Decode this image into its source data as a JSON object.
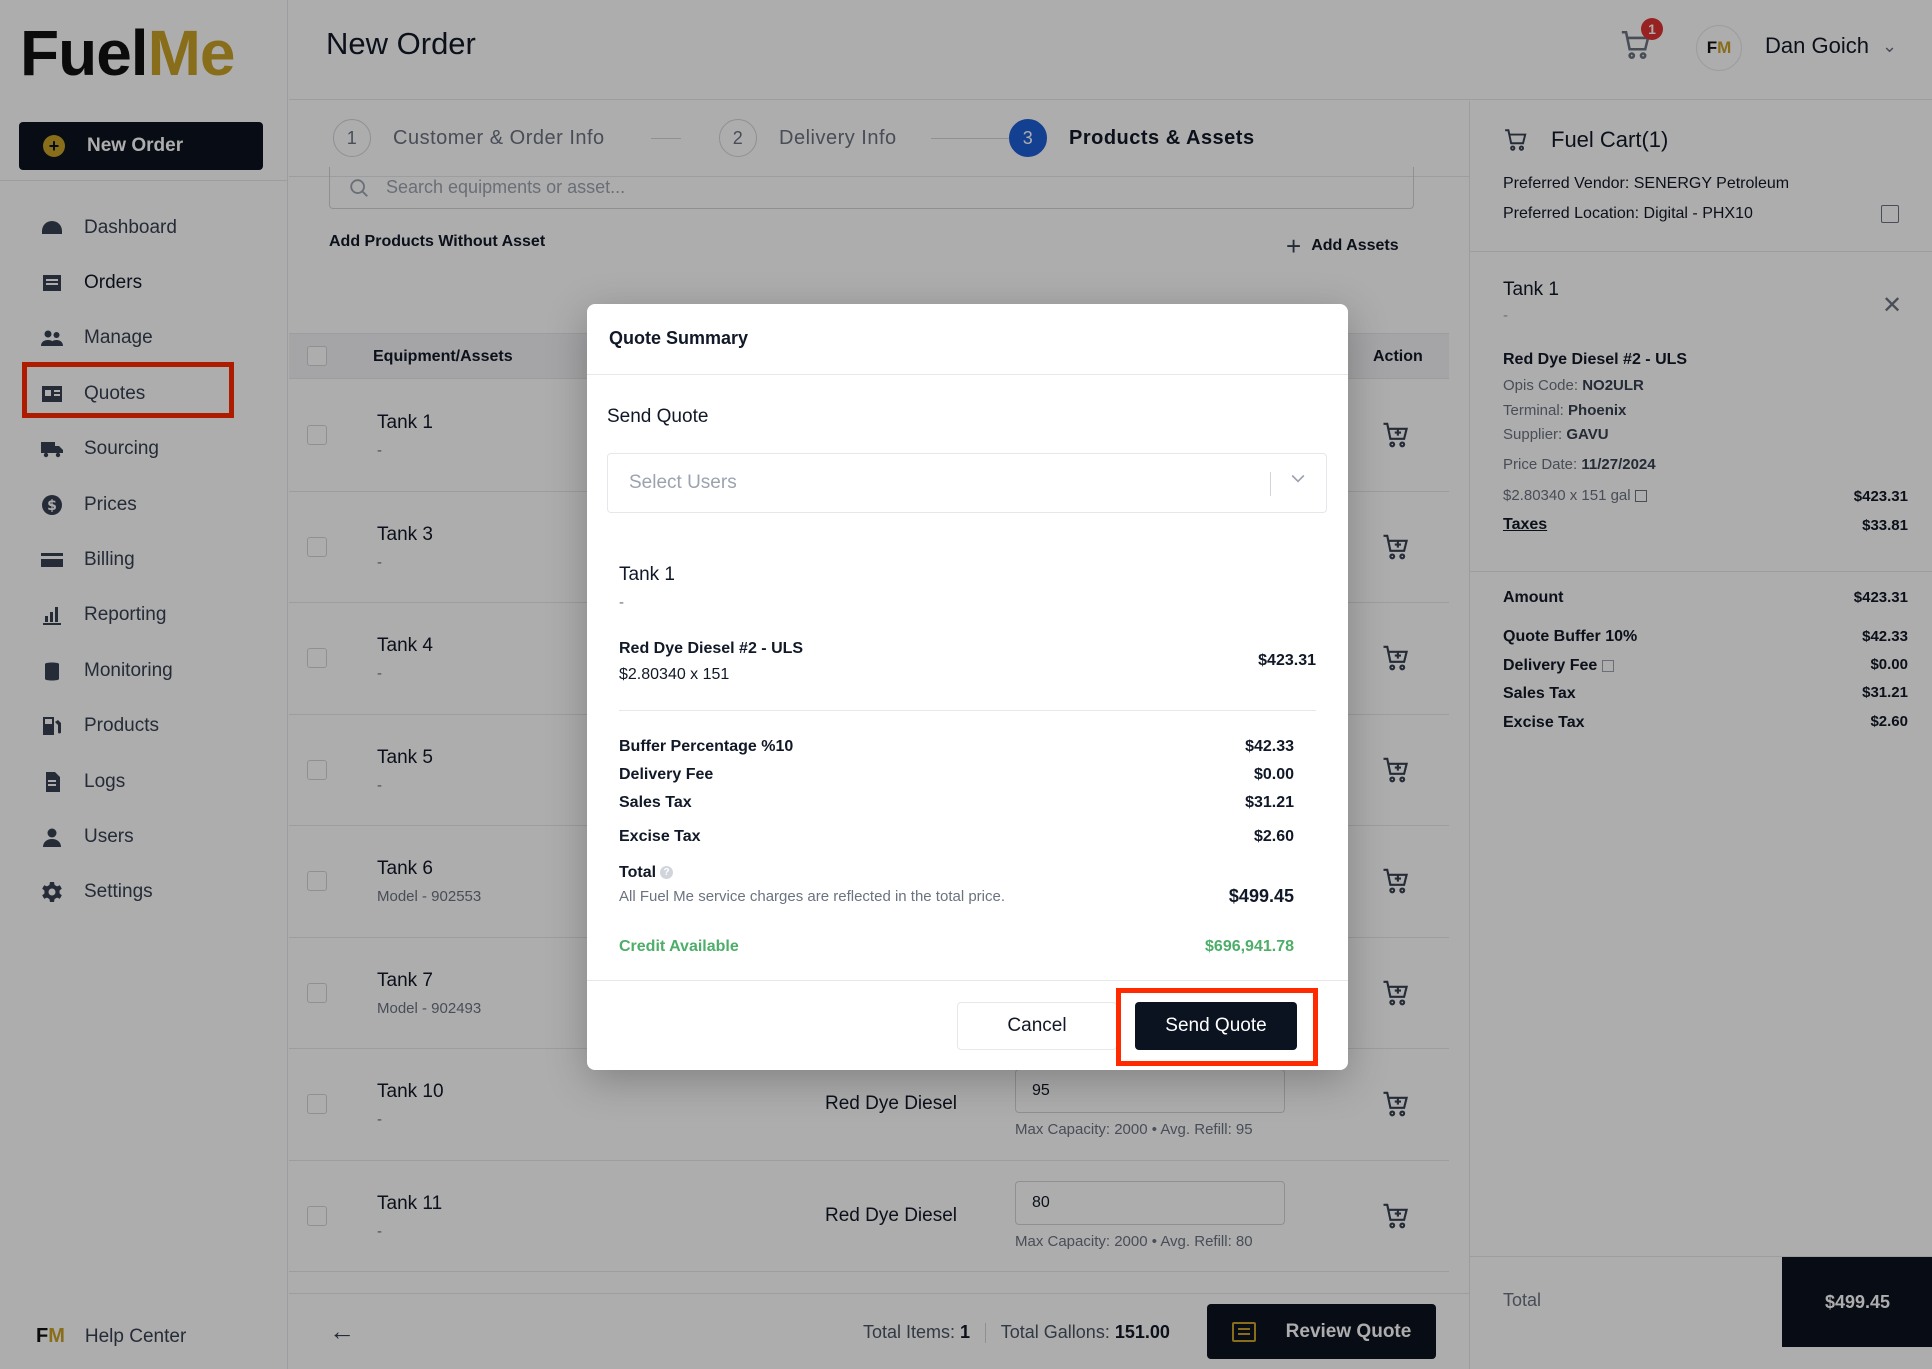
{
  "brand": {
    "logo_fuel": "Fuel",
    "logo_me": "Me",
    "accent": "#c9a227",
    "dark": "#0b1220"
  },
  "sidebar": {
    "new_order_label": "New Order",
    "items": [
      {
        "label": "Dashboard",
        "icon": "speedometer-icon"
      },
      {
        "label": "Orders",
        "icon": "list-icon"
      },
      {
        "label": "Manage",
        "icon": "people-icon"
      },
      {
        "label": "Quotes",
        "icon": "quote-card-icon"
      },
      {
        "label": "Sourcing",
        "icon": "truck-icon"
      },
      {
        "label": "Prices",
        "icon": "dollar-icon"
      },
      {
        "label": "Billing",
        "icon": "credit-card-icon"
      },
      {
        "label": "Reporting",
        "icon": "bar-chart-icon"
      },
      {
        "label": "Monitoring",
        "icon": "tank-icon"
      },
      {
        "label": "Products",
        "icon": "fuel-pump-icon"
      },
      {
        "label": "Logs",
        "icon": "document-icon"
      },
      {
        "label": "Users",
        "icon": "user-icon"
      },
      {
        "label": "Settings",
        "icon": "gear-icon"
      }
    ],
    "help_label": "Help Center"
  },
  "header": {
    "title": "New Order",
    "cart_count": "1",
    "avatar_initials_f": "F",
    "avatar_initials_m": "M",
    "user_name": "Dan Goich"
  },
  "stepper": {
    "steps": [
      {
        "num": "1",
        "label": "Customer & Order Info"
      },
      {
        "num": "2",
        "label": "Delivery Info"
      },
      {
        "num": "3",
        "label": "Products & Assets"
      }
    ]
  },
  "main": {
    "search_placeholder": "Search equipments or asset...",
    "add_without_asset": "Add Products Without Asset",
    "add_assets": "Add Assets",
    "columns": {
      "equipment": "Equipment/Assets",
      "action": "Action"
    },
    "rows": [
      {
        "name": "Tank 1",
        "sub": "-",
        "product": "",
        "qty": "",
        "hint": ""
      },
      {
        "name": "Tank 3",
        "sub": "-",
        "product": "",
        "qty": "",
        "hint": ""
      },
      {
        "name": "Tank 4",
        "sub": "-",
        "product": "",
        "qty": "",
        "hint": ""
      },
      {
        "name": "Tank 5",
        "sub": "-",
        "product": "",
        "qty": "",
        "hint": ""
      },
      {
        "name": "Tank 6",
        "sub": "Model - 902553",
        "product": "",
        "qty": "",
        "hint": ""
      },
      {
        "name": "Tank 7",
        "sub": "Model - 902493",
        "product": "",
        "qty": "",
        "hint": ""
      },
      {
        "name": "Tank 10",
        "sub": "-",
        "product": "Red Dye Diesel",
        "qty": "95",
        "hint": "Max Capacity: 2000 • Avg. Refill: 95"
      },
      {
        "name": "Tank 11",
        "sub": "-",
        "product": "Red Dye Diesel",
        "qty": "80",
        "hint": "Max Capacity: 2000 • Avg. Refill: 80"
      }
    ],
    "footer": {
      "total_items_label": "Total Items:",
      "total_items": "1",
      "total_gallons_label": "Total Gallons:",
      "total_gallons": "151.00",
      "review_label": "Review Quote"
    }
  },
  "cart": {
    "title": "Fuel Cart(1)",
    "vendor": "Preferred Vendor: SENERGY Petroleum",
    "location": "Preferred Location: Digital - PHX10",
    "tank": "Tank 1",
    "tank_sub": "-",
    "product": "Red Dye Diesel #2 - ULS",
    "opis_label": "Opis Code:",
    "opis": "NO2ULR",
    "terminal_label": "Terminal:",
    "terminal": "Phoenix",
    "supplier_label": "Supplier:",
    "supplier": "GAVU",
    "price_date_label": "Price Date:",
    "price_date": "11/27/2024",
    "calc": "$2.80340 x 151 gal",
    "calc_amount": "$423.31",
    "taxes_label": "Taxes",
    "taxes_amount": "$33.81",
    "summary": [
      {
        "label": "Amount",
        "value": "$423.31"
      },
      {
        "label": "Quote Buffer 10%",
        "value": "$42.33"
      },
      {
        "label": "Delivery Fee",
        "value": "$0.00"
      },
      {
        "label": "Sales Tax",
        "value": "$31.21"
      },
      {
        "label": "Excise Tax",
        "value": "$2.60"
      }
    ],
    "total_label": "Total",
    "total_value": "$499.45"
  },
  "modal": {
    "title": "Quote Summary",
    "send_label": "Send Quote",
    "select_placeholder": "Select Users",
    "tank": "Tank 1",
    "tank_sub": "-",
    "product": "Red Dye Diesel #2 - ULS",
    "product_calc": "$2.80340 x 151",
    "product_amount": "$423.31",
    "lines": [
      {
        "label": "Buffer Percentage %10",
        "value": "$42.33"
      },
      {
        "label": "Delivery Fee",
        "value": "$0.00"
      },
      {
        "label": "Sales Tax",
        "value": "$31.21"
      },
      {
        "label": "Excise Tax",
        "value": "$2.60"
      }
    ],
    "total_label": "Total",
    "total_note": "All Fuel Me service charges are reflected in the total price.",
    "total_value": "$499.45",
    "credit_label": "Credit Available",
    "credit_value": "$696,941.78",
    "cancel_label": "Cancel",
    "send_button_label": "Send Quote"
  }
}
